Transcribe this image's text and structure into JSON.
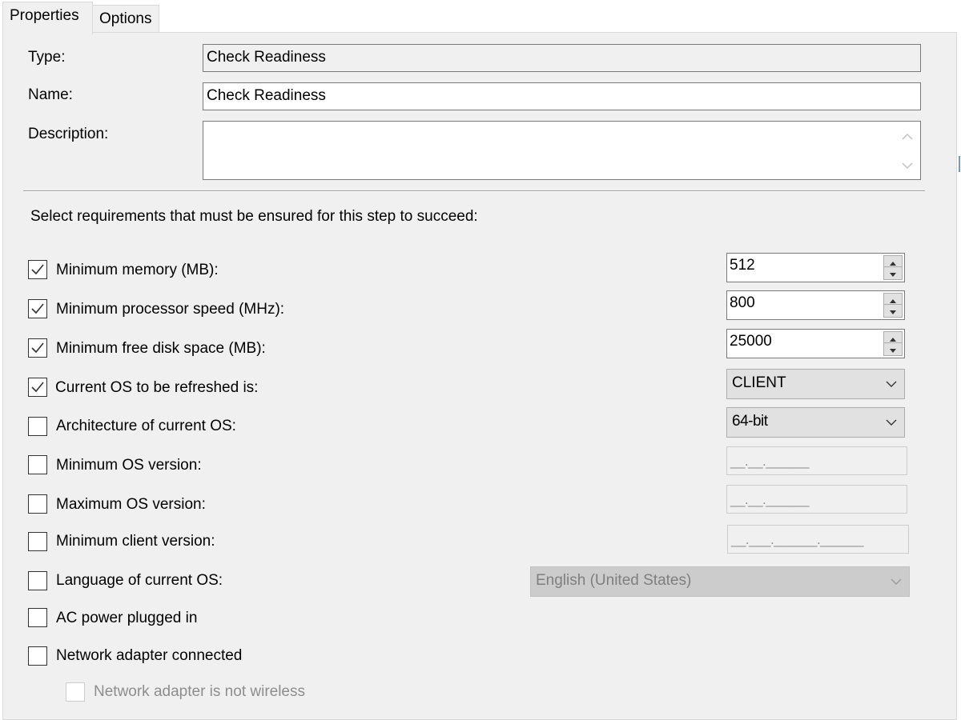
{
  "tabs": [
    {
      "label": "Properties",
      "active": true
    },
    {
      "label": "Options",
      "active": false
    }
  ],
  "fields": {
    "type_label": "Type:",
    "type_value": "Check Readiness",
    "name_label": "Name:",
    "name_value": "Check Readiness",
    "description_label": "Description:",
    "description_value": ""
  },
  "requirements_heading": "Select requirements that must be ensured for this step to succeed:",
  "requirements": {
    "min_memory": {
      "label": "Minimum memory (MB):",
      "checked": true,
      "value": "512"
    },
    "min_processor": {
      "label": "Minimum processor speed (MHz):",
      "checked": true,
      "value": "800"
    },
    "min_disk": {
      "label": "Minimum free disk space (MB):",
      "checked": true,
      "value": "25000"
    },
    "current_os": {
      "label": "Current OS to be refreshed is:",
      "checked": true,
      "value": "CLIENT"
    },
    "architecture": {
      "label": "Architecture of current OS:",
      "checked": false,
      "value": "64-bit"
    },
    "min_os_version": {
      "label": "Minimum OS version:",
      "checked": false,
      "mask": "__.__.______"
    },
    "max_os_version": {
      "label": "Maximum OS version:",
      "checked": false,
      "mask": "__.__.______"
    },
    "min_client_version": {
      "label": "Minimum client version:",
      "checked": false,
      "mask": "__.___.______.______"
    },
    "language": {
      "label": "Language of current OS:",
      "checked": false,
      "value": "English (United States)"
    },
    "ac_power": {
      "label": "AC power plugged in",
      "checked": false
    },
    "network_connected": {
      "label": "Network adapter connected",
      "checked": false
    },
    "network_not_wireless": {
      "label": "Network adapter is not wireless",
      "checked": false,
      "enabled": false
    }
  },
  "colors": {
    "panel_bg": "#f0f0f0",
    "field_border": "#7a7a7a",
    "disabled_text": "#8d8d8d"
  }
}
